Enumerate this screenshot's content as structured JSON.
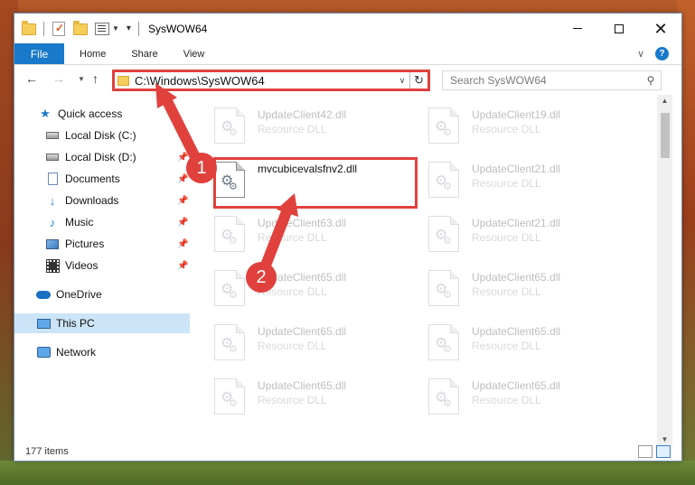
{
  "window": {
    "title": "SysWOW64",
    "controls": {
      "minimize": "minimize",
      "maximize": "maximize",
      "close": "✕"
    }
  },
  "ribbon": {
    "file_tab": "File",
    "tabs": [
      "Home",
      "Share",
      "View"
    ],
    "help": "?"
  },
  "navbar": {
    "address": "C:\\Windows\\SysWOW64",
    "search_placeholder": "Search SysWOW64"
  },
  "sidebar": {
    "items": [
      {
        "label": "Quick access",
        "icon": "star-icon",
        "pinned": false
      },
      {
        "label": "Local Disk (C:)",
        "icon": "disk-icon",
        "pinned": false
      },
      {
        "label": "Local Disk (D:)",
        "icon": "disk-icon",
        "pinned": true
      },
      {
        "label": "Documents",
        "icon": "documents-icon",
        "pinned": true
      },
      {
        "label": "Downloads",
        "icon": "download-icon",
        "pinned": true
      },
      {
        "label": "Music",
        "icon": "music-icon",
        "pinned": true
      },
      {
        "label": "Pictures",
        "icon": "pictures-icon",
        "pinned": true
      },
      {
        "label": "Videos",
        "icon": "videos-icon",
        "pinned": true
      },
      {
        "label": "OneDrive",
        "icon": "cloud-icon",
        "pinned": false
      },
      {
        "label": "This PC",
        "icon": "computer-icon",
        "pinned": false,
        "selected": true
      },
      {
        "label": "Network",
        "icon": "network-icon",
        "pinned": false
      }
    ]
  },
  "files": {
    "highlighted": {
      "name": "mvcubicevalsfnv2.dll",
      "type": ""
    },
    "left_column": [
      {
        "name": "UpdateClient42.dll",
        "type": "Resource DLL"
      },
      {
        "name": "UpdateClient63.dll",
        "type": "Resource DLL"
      },
      {
        "name": "UpdateClient65.dll",
        "type": "Resource DLL"
      },
      {
        "name": "UpdateClient65.dll",
        "type": "Resource DLL"
      },
      {
        "name": "UpdateClient65.dll",
        "type": "Resource DLL"
      }
    ],
    "right_column": [
      {
        "name": "UpdateClient19.dll",
        "type": "Resource DLL"
      },
      {
        "name": "UpdateClient21.dll",
        "type": "Resource DLL"
      },
      {
        "name": "UpdateClient21.dll",
        "type": "Resource DLL"
      },
      {
        "name": "UpdateClient65.dll",
        "type": "Resource DLL"
      },
      {
        "name": "UpdateClient65.dll",
        "type": "Resource DLL"
      },
      {
        "name": "UpdateClient65.dll",
        "type": "Resource DLL"
      }
    ]
  },
  "status": {
    "count": "177 items"
  },
  "callouts": [
    "1",
    "2"
  ],
  "colors": {
    "accent": "#1979ca",
    "callout": "#e0413d",
    "selected": "#cce4f7"
  }
}
